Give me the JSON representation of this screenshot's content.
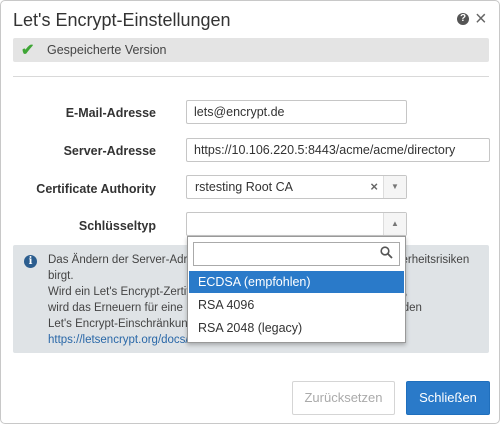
{
  "dialog": {
    "title": "Let's Encrypt-Einstellungen",
    "help_icon": "question-icon",
    "close_icon": "close-icon",
    "close_symbol": "×",
    "help_symbol": "?"
  },
  "status": {
    "icon": "check-icon",
    "symbol": "✔",
    "text": "Gespeicherte Version"
  },
  "form": {
    "email_label": "E-Mail-Adresse",
    "email_value": "lets@encrypt.de",
    "server_label": "Server-Adresse",
    "server_value": "https://10.106.220.5:8443/acme/acme/directory",
    "ca_label": "Certificate Authority",
    "ca_value": "rstesting Root CA",
    "ca_clear_symbol": "×",
    "keytype_label": "Schlüsseltyp",
    "keytype_value": ""
  },
  "info": {
    "icon": "info-icon",
    "symbol": "i",
    "line1": "Das Ändern der Server-Adresse wird nicht empfohlen, da dieses Sicherheitsrisiken birgt.",
    "line2": "Wird ein Let's Encrypt-Zertifikat aktiviert, wird es automatisch erneuert,",
    "line3": "wird das Erneuern für eine Domain erst möglich sein, Einzelheiten zu den",
    "line4": "Let's Encrypt-Einschränkungen finden Sie unter",
    "link": "https://letsencrypt.org/docs/rate-limits/"
  },
  "dropdown": {
    "search_placeholder": "",
    "search_icon": "search-icon",
    "options": [
      "ECDSA (empfohlen)",
      "RSA 4096",
      "RSA 2048 (legacy)"
    ],
    "selected_index": 0
  },
  "buttons": {
    "reset": "Zurücksetzen",
    "close": "Schließen"
  },
  "colors": {
    "accent": "#2a7ac9",
    "success": "#3fa636",
    "info_bg": "#dfe3e6"
  }
}
